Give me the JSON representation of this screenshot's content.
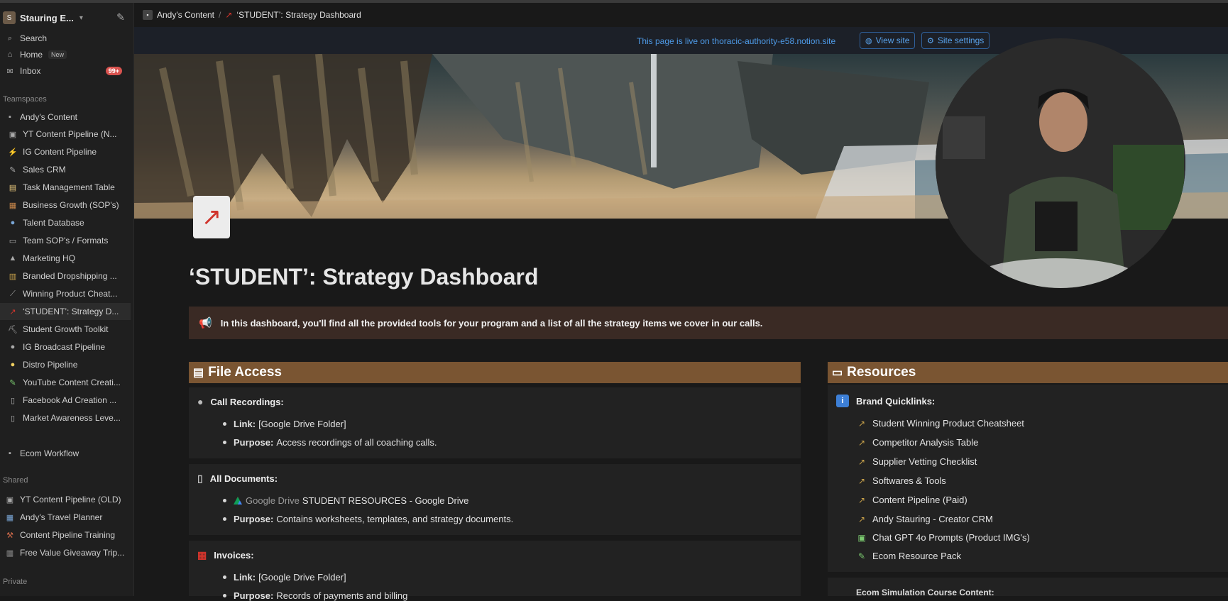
{
  "sidebar": {
    "workspace": "Stauring E...",
    "top": [
      {
        "label": "Search",
        "icon": "search-icon"
      },
      {
        "label": "Home",
        "icon": "home-icon",
        "badge": "New"
      },
      {
        "label": "Inbox",
        "icon": "inbox-icon",
        "count": "99+"
      }
    ],
    "teamspaces_label": "Teamspaces",
    "teamspace": "Andy's Content",
    "pages": [
      {
        "label": "YT Content Pipeline (N..."
      },
      {
        "label": "IG Content Pipeline"
      },
      {
        "label": "Sales CRM"
      },
      {
        "label": "Task Management Table"
      },
      {
        "label": "Business Growth (SOP's)"
      },
      {
        "label": "Talent Database"
      },
      {
        "label": "Team SOP's / Formats"
      },
      {
        "label": "Marketing HQ"
      },
      {
        "label": "Branded Dropshipping ..."
      },
      {
        "label": "Winning Product Cheat..."
      },
      {
        "label": "‘STUDENT’: Strategy D..."
      },
      {
        "label": "Student Growth Toolkit"
      },
      {
        "label": "IG Broadcast Pipeline"
      },
      {
        "label": "Distro Pipeline"
      },
      {
        "label": "YouTube Content Creati..."
      },
      {
        "label": "Facebook Ad Creation ..."
      },
      {
        "label": "Market Awareness Leve..."
      }
    ],
    "ecom": "Ecom Workflow",
    "shared_label": "Shared",
    "shared": [
      {
        "label": "YT Content Pipeline (OLD)"
      },
      {
        "label": "Andy's Travel Planner"
      },
      {
        "label": "Content Pipeline Training"
      },
      {
        "label": "Free Value Giveaway Trip..."
      }
    ],
    "private_label": "Private"
  },
  "breadcrumb": {
    "parent": "Andy's Content",
    "current": "‘STUDENT’: Strategy Dashboard"
  },
  "live": {
    "text": "This page is live on thoracic-authority-e58.notion.site",
    "view": "View site",
    "settings": "Site settings"
  },
  "page": {
    "title": "‘STUDENT’: Strategy Dashboard",
    "callout": "In this dashboard, you'll find all the provided tools for your program and a list of all the strategy items we cover in our calls."
  },
  "file_access": {
    "heading": "File Access",
    "call_recordings": {
      "title": "Call Recordings:",
      "link_label": "Link:",
      "link_value": "[Google Drive Folder]",
      "purpose_label": "Purpose:",
      "purpose_value": "Access recordings of all coaching calls."
    },
    "all_documents": {
      "title": "All Documents:",
      "gd_label": "Google Drive",
      "gd_value": "STUDENT RESOURCES - Google Drive",
      "purpose_label": "Purpose:",
      "purpose_value": "Contains worksheets, templates, and strategy documents."
    },
    "invoices": {
      "title": "Invoices:",
      "link_label": "Link:",
      "link_value": "[Google Drive Folder]",
      "purpose_label": "Purpose:",
      "purpose_value": "Records of payments and billing"
    }
  },
  "resources": {
    "heading": "Resources",
    "quicklinks_title": "Brand Quicklinks:",
    "items": [
      {
        "label": "Student Winning Product Cheatsheet"
      },
      {
        "label": "Competitor Analysis Table"
      },
      {
        "label": "Supplier Vetting Checklist"
      },
      {
        "label": "Softwares & Tools"
      },
      {
        "label": "Content Pipeline (Paid)"
      },
      {
        "label": "Andy Stauring - Creator CRM"
      },
      {
        "label": "Chat GPT 4o Prompts (Product IMG's)"
      },
      {
        "label": "Ecom Resource Pack"
      }
    ],
    "next_title": "Ecom Simulation Course Content:"
  }
}
